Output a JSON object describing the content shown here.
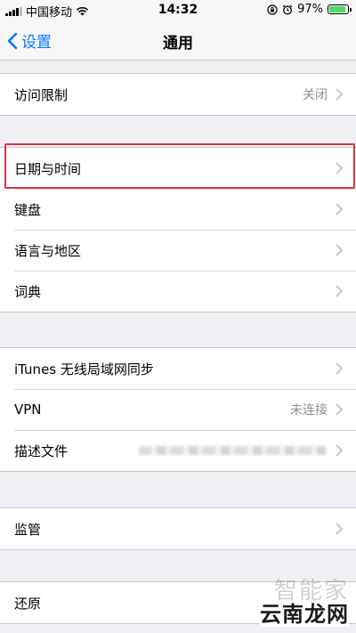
{
  "status_bar": {
    "carrier": "中国移动",
    "time": "14:32",
    "battery_percent": "97%",
    "battery_level": 0.97
  },
  "nav": {
    "back_label": "设置",
    "title": "通用"
  },
  "groups": [
    {
      "items": [
        {
          "label": "访问限制",
          "value": "关闭"
        }
      ]
    },
    {
      "items": [
        {
          "label": "日期与时间",
          "value": ""
        },
        {
          "label": "键盘",
          "value": ""
        },
        {
          "label": "语言与地区",
          "value": ""
        },
        {
          "label": "词典",
          "value": ""
        }
      ]
    },
    {
      "items": [
        {
          "label": "iTunes 无线局域网同步",
          "value": ""
        },
        {
          "label": "VPN",
          "value": "未连接"
        },
        {
          "label": "描述文件",
          "value": ""
        }
      ]
    },
    {
      "items": [
        {
          "label": "监管",
          "value": ""
        }
      ]
    },
    {
      "items": [
        {
          "label": "还原",
          "value": ""
        }
      ]
    }
  ],
  "watermark": {
    "top": "智能家",
    "bottom": "云南龙网"
  },
  "colors": {
    "accent": "#007aff",
    "highlight": "#d9363e",
    "battery": "#4cd964"
  }
}
